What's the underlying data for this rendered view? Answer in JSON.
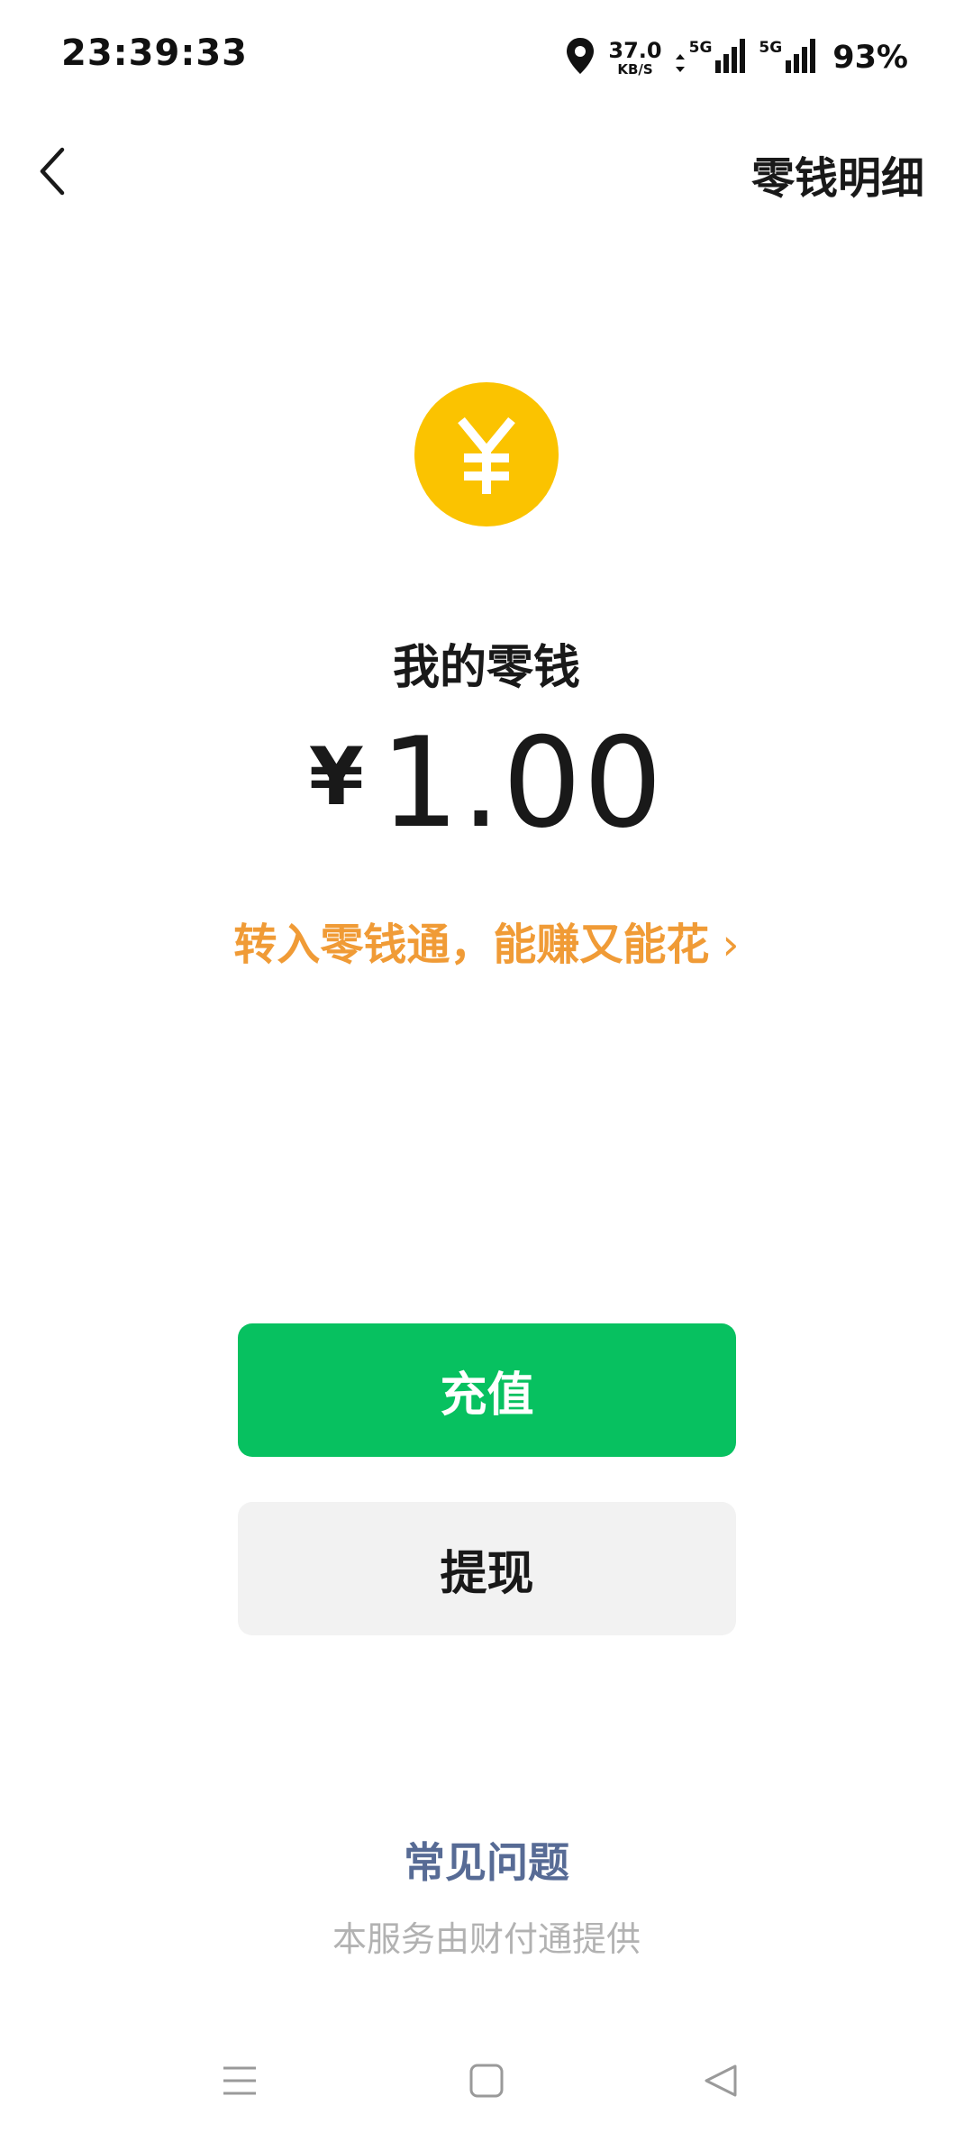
{
  "status_bar": {
    "time": "23:39:33",
    "net_speed_value": "37.0",
    "net_speed_unit": "KB/S",
    "sim1_label": "5G",
    "sim2_label": "5G",
    "battery": "93%",
    "icons": [
      "location-icon",
      "data-arrows-icon",
      "signal-icon",
      "signal-icon"
    ]
  },
  "nav": {
    "back_icon": "chevron-left-icon",
    "detail_label": "零钱明细"
  },
  "balance": {
    "coin_symbol": "¥",
    "title": "我的零钱",
    "currency": "¥",
    "amount": "1.00",
    "promo_text": "转入零钱通，能赚又能花",
    "promo_chevron": "›"
  },
  "actions": {
    "recharge_label": "充值",
    "withdraw_label": "提现"
  },
  "footer": {
    "faq_label": "常见问题",
    "provider_text": "本服务由财付通提供"
  },
  "system_nav": {
    "icons": [
      "menu-icon",
      "home-icon",
      "back-triangle-icon"
    ]
  },
  "colors": {
    "primary_green": "#07c160",
    "coin_yellow": "#fbc300",
    "promo_orange": "#f09b36",
    "link_blue": "#576b95",
    "muted_gray": "#b2b2b2",
    "button_gray": "#f2f2f2"
  }
}
